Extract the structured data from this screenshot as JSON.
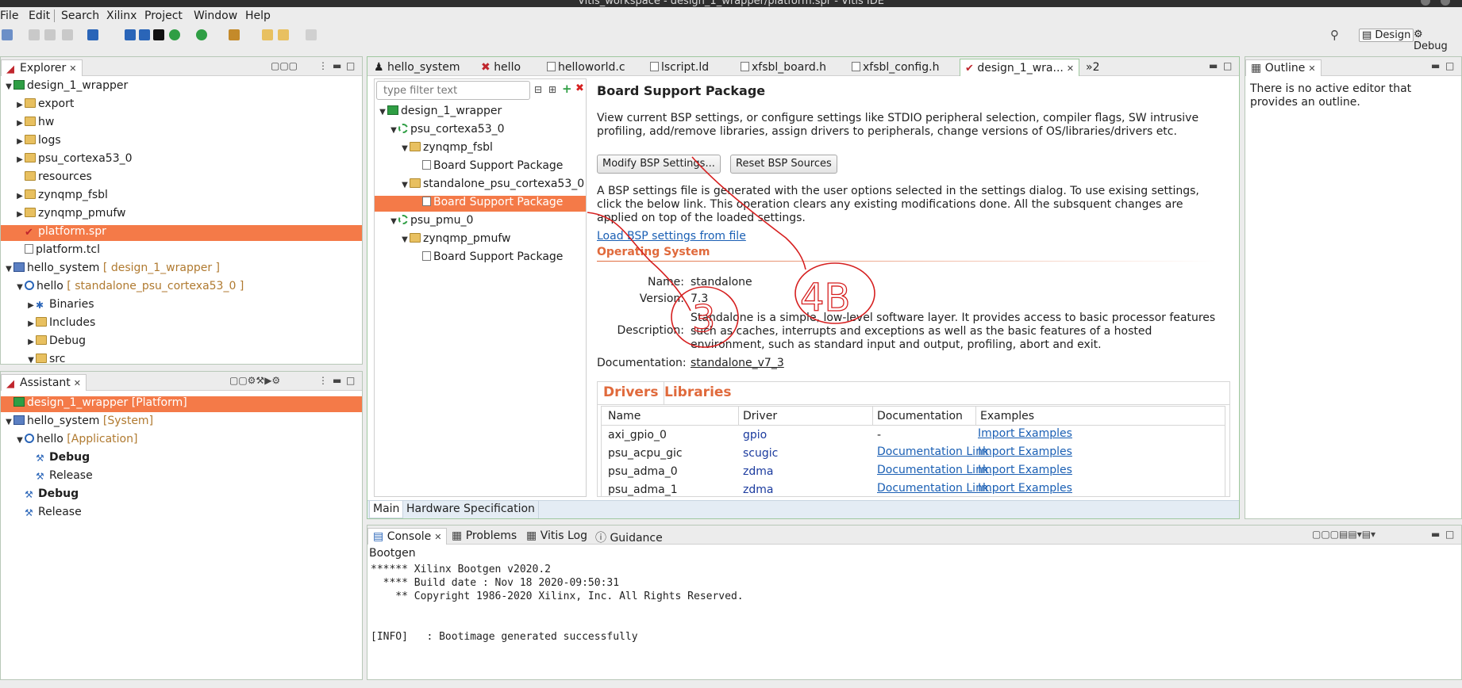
{
  "window": {
    "title": "Vitis_workspace - design_1_wrapper/platform.spr - Vitis IDE"
  },
  "menu": [
    "File",
    "Edit",
    "Search",
    "Xilinx",
    "Project",
    "Window",
    "Help"
  ],
  "perspectives": {
    "design": "Design",
    "debug": "Debug"
  },
  "explorer": {
    "tab": "Explorer",
    "items": [
      {
        "label": "design_1_wrapper",
        "suffix": ""
      },
      {
        "label": "export",
        "suffix": ""
      },
      {
        "label": "hw",
        "suffix": ""
      },
      {
        "label": "logs",
        "suffix": ""
      },
      {
        "label": "psu_cortexa53_0",
        "suffix": ""
      },
      {
        "label": "resources",
        "suffix": ""
      },
      {
        "label": "zynqmp_fsbl",
        "suffix": ""
      },
      {
        "label": "zynqmp_pmufw",
        "suffix": ""
      },
      {
        "label": "platform.spr",
        "suffix": ""
      },
      {
        "label": "platform.tcl",
        "suffix": ""
      },
      {
        "label": "hello_system",
        "suffix": "[ design_1_wrapper ]"
      },
      {
        "label": "hello",
        "suffix": "[ standalone_psu_cortexa53_0 ]"
      },
      {
        "label": "Binaries",
        "suffix": ""
      },
      {
        "label": "Includes",
        "suffix": ""
      },
      {
        "label": "Debug",
        "suffix": ""
      },
      {
        "label": "src",
        "suffix": ""
      }
    ]
  },
  "assistant": {
    "tab": "Assistant",
    "items": [
      {
        "label": "design_1_wrapper",
        "suffix": "[Platform]"
      },
      {
        "label": "hello_system",
        "suffix": "[System]"
      },
      {
        "label": "hello",
        "suffix": "[Application]"
      },
      {
        "label": "Debug",
        "suffix": ""
      },
      {
        "label": "Release",
        "suffix": ""
      },
      {
        "label": "Debug",
        "suffix": ""
      },
      {
        "label": "Release",
        "suffix": ""
      }
    ]
  },
  "editor_tabs": [
    "hello_system",
    "hello",
    "helloworld.c",
    "lscript.ld",
    "xfsbl_board.h",
    "xfsbl_config.h",
    "design_1_wra...",
    "»2"
  ],
  "platform_tree": {
    "filter_placeholder": "type filter text",
    "items": [
      "design_1_wrapper",
      "psu_cortexa53_0",
      "zynqmp_fsbl",
      "Board Support Package",
      "standalone_psu_cortexa53_0",
      "Board Support Package",
      "psu_pmu_0",
      "zynqmp_pmufw",
      "Board Support Package"
    ]
  },
  "bsp": {
    "title": "Board Support Package",
    "intro": "View current BSP settings, or configure settings like STDIO peripheral selection, compiler flags, SW intrusive profiling, add/remove libraries, assign drivers to peripherals, change versions of OS/libraries/drivers etc.",
    "modify_button": "Modify BSP Settings...",
    "reset_button": "Reset BSP Sources",
    "settings_note": "A BSP settings file is generated with the user options selected in the settings dialog. To use exising settings, click the below link. This operation clears any existing modifications done. All the subsquent changes are applied on top of the loaded settings.",
    "load_link": "Load BSP settings from file",
    "os_section": "Operating System",
    "name_label": "Name:",
    "name_value": "standalone",
    "version_label": "Version:",
    "version_value": "7.3",
    "description_label": "Description:",
    "description_value": "Standalone is a simple, low-level software layer. It provides access to basic processor features such as caches, interrupts and exceptions as well as the basic features of a hosted environment, such as standard input and output, profiling, abort and exit.",
    "documentation_label": "Documentation:",
    "documentation_link": "standalone_v7_3",
    "tabs": [
      "Drivers",
      "Libraries"
    ],
    "table": {
      "headers": [
        "Name",
        "Driver",
        "Documentation",
        "Examples"
      ],
      "rows": [
        [
          "axi_gpio_0",
          "gpio",
          "-",
          "Import Examples"
        ],
        [
          "psu_acpu_gic",
          "scugic",
          "Documentation Link",
          "Import Examples"
        ],
        [
          "psu_adma_0",
          "zdma",
          "Documentation Link",
          "Import Examples"
        ],
        [
          "psu_adma_1",
          "zdma",
          "Documentation Link",
          "Import Examples"
        ]
      ]
    },
    "bottom_tabs": [
      "Main",
      "Hardware Specification"
    ]
  },
  "outline": {
    "tab": "Outline",
    "message": "There is no active editor that provides an outline."
  },
  "console": {
    "tabs": [
      "Console",
      "Problems",
      "Vitis Log",
      "Guidance"
    ],
    "name": "Bootgen",
    "lines": [
      "****** Xilinx Bootgen v2020.2",
      "  **** Build date : Nov 18 2020-09:50:31",
      "    ** Copyright 1986-2020 Xilinx, Inc. All Rights Reserved.",
      "",
      "",
      "[INFO]   : Bootimage generated successfully"
    ]
  },
  "annotations": {
    "left": "3",
    "right": "4B"
  },
  "colors": {
    "selection": "#f47a48",
    "section": "#e06a3c",
    "link": "#1a5fb4",
    "ink": "#d62020"
  }
}
